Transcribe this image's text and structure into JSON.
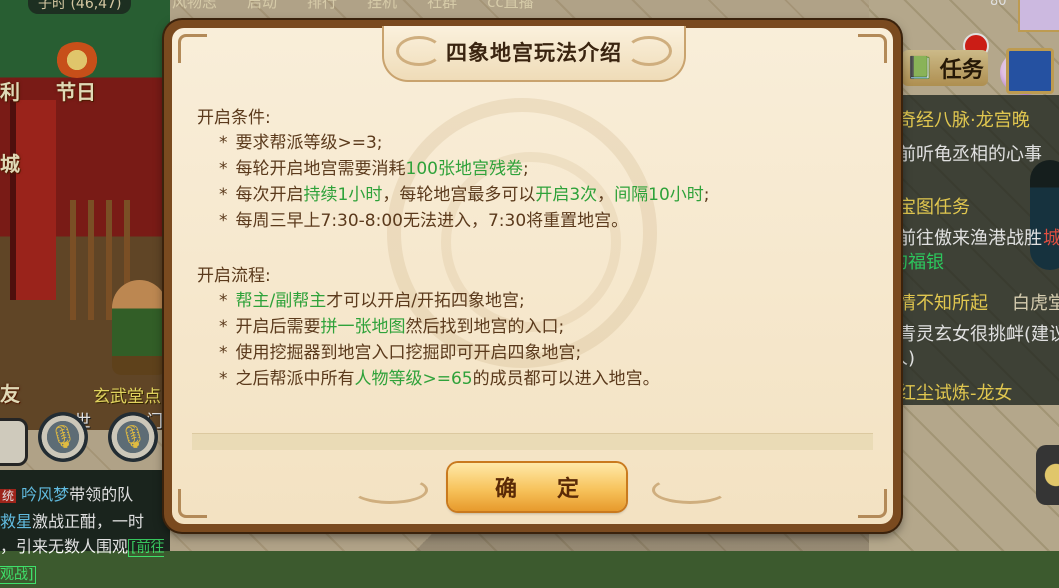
{
  "hud": {
    "coords": "子时 (46,47)",
    "top_menu": [
      "风物志",
      "启动",
      "排行",
      "挂机",
      "社群",
      "cc直播"
    ],
    "top_right_number": "80",
    "left_labels": {
      "li": "利",
      "festival": "节日",
      "cheng": "城",
      "you": "友"
    },
    "npc_name": "玄武堂点",
    "npc_sub_left": "世",
    "npc_sub_right": "门"
  },
  "chat": {
    "line1_tag": "统",
    "line1_name": "吟风梦",
    "line1_text": "带领的队",
    "line2_name": "救星",
    "line2_text": "激战正酣，一时",
    "line3_text": "，引来无数人围观",
    "line3_link": "[前往观战]"
  },
  "tasks": {
    "button_label": "任务",
    "rows": [
      {
        "text": "奇经八脉·龙宫晚",
        "color": "yellow"
      },
      {
        "text": "前听龟丞相的心事",
        "color": "white"
      },
      {
        "text": "宝图任务",
        "color": "yellow"
      },
      {
        "text": "前往傲来渔港战胜",
        "color": "white"
      },
      {
        "text": "城",
        "color": "red"
      },
      {
        "text": "的福银",
        "color": "green"
      },
      {
        "text": "情不知所起",
        "color": "yellow"
      },
      {
        "text": "白虎堂",
        "color": "cream"
      },
      {
        "text": "青灵玄女很挑衅(建议",
        "color": "white"
      },
      {
        "text": "人)",
        "color": "white"
      },
      {
        "text": "红尘试炼-龙女",
        "color": "yellow"
      }
    ]
  },
  "dialog": {
    "title": "四象地宫玩法介绍",
    "sections": [
      {
        "title": "开启条件:",
        "items": [
          [
            {
              "t": "要求帮派等级>=3;"
            }
          ],
          [
            {
              "t": "每轮开启地宫需要消耗"
            },
            {
              "t": "100张地宫残卷",
              "g": true
            },
            {
              "t": ";"
            }
          ],
          [
            {
              "t": "每次开启"
            },
            {
              "t": "持续1小时",
              "g": true
            },
            {
              "t": "，每轮地宫最多可以"
            },
            {
              "t": "开启3次",
              "g": true
            },
            {
              "t": "，"
            },
            {
              "t": "间隔10小时",
              "g": true
            },
            {
              "t": ";"
            }
          ],
          [
            {
              "t": "每周三早上7:30-8:00无法进入，7:30将重置地宫。"
            }
          ]
        ]
      },
      {
        "title": "开启流程:",
        "items": [
          [
            {
              "t": "帮主/副帮主",
              "g": true
            },
            {
              "t": "才可以开启/开拓四象地宫;"
            }
          ],
          [
            {
              "t": "开启后需要"
            },
            {
              "t": "拼一张地图",
              "g": true
            },
            {
              "t": "然后找到地宫的入口;"
            }
          ],
          [
            {
              "t": "使用挖掘器到地宫入口挖掘即可开启四象地宫;"
            }
          ],
          [
            {
              "t": "之后帮派中所有"
            },
            {
              "t": "人物等级>=65",
              "g": true
            },
            {
              "t": "的成员都可以进入地宫。"
            }
          ]
        ]
      }
    ],
    "bullet": "*",
    "confirm_label": "确定"
  },
  "colors": {
    "highlight_green": "#2fa23a",
    "body_text": "#5b3a1c",
    "panel_bg": "#f6e8cf",
    "button_gold": "#f7c35c"
  }
}
